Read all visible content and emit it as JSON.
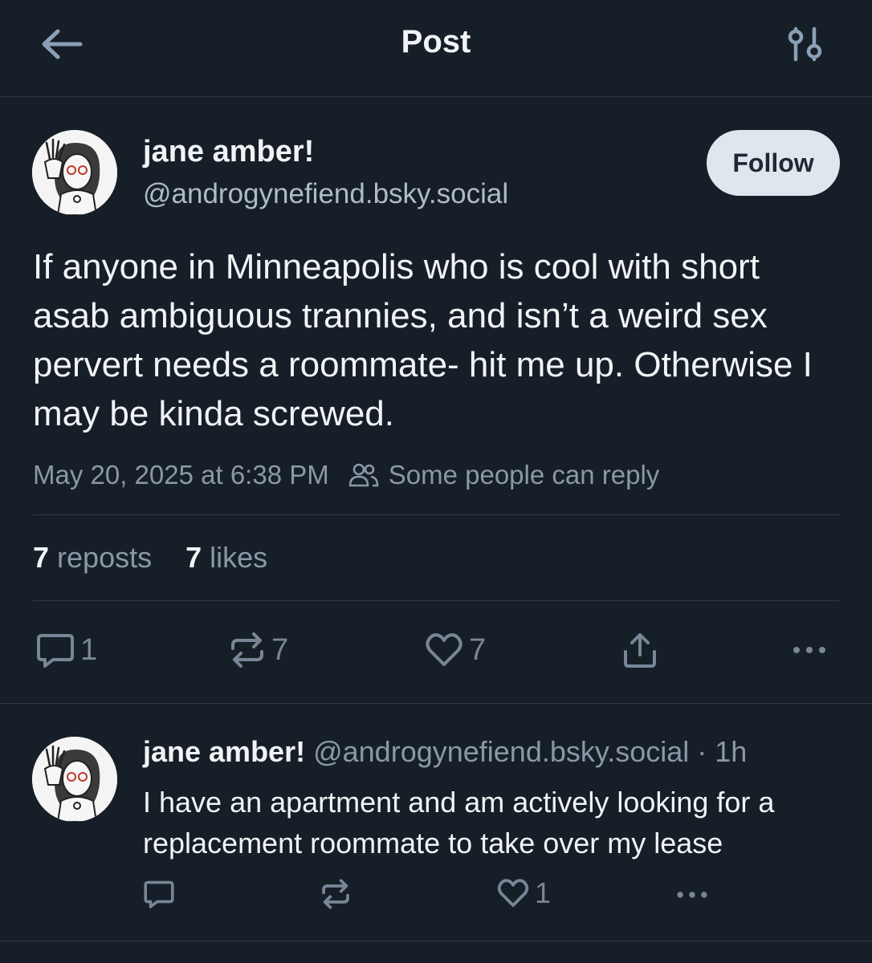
{
  "header": {
    "title": "Post",
    "back_icon": "arrow-left-icon",
    "filter_icon": "sliders-icon"
  },
  "post": {
    "author_name": "jane amber!",
    "author_handle": "@androgynefiend.bsky.social",
    "follow_label": "Follow",
    "text": "If anyone in Minneapolis who is cool with short asab ambiguous trannies, and isn’t a weird sex pervert needs a roommate- hit me up. Otherwise I may be kinda screwed.",
    "timestamp": "May 20, 2025 at 6:38 PM",
    "reply_permission": "Some people can reply",
    "reposts_count": "7",
    "reposts_label": "reposts",
    "likes_count": "7",
    "likes_label": "likes",
    "actions": {
      "reply_count": "1",
      "repost_count": "7",
      "like_count": "7"
    }
  },
  "reply": {
    "author_name": "jane amber!",
    "author_handle": "@androgynefiend.bsky.social",
    "time": "· 1h",
    "text": "I have an apartment and am actively looking for a replacement roommate to take over my lease",
    "actions": {
      "like_count": "1"
    }
  },
  "colors": {
    "background": "#161e27",
    "text_primary": "#f1f3f5",
    "text_secondary": "#8a98a8",
    "follow_button_bg": "#dfe6ee",
    "divider": "#2e3a47"
  }
}
